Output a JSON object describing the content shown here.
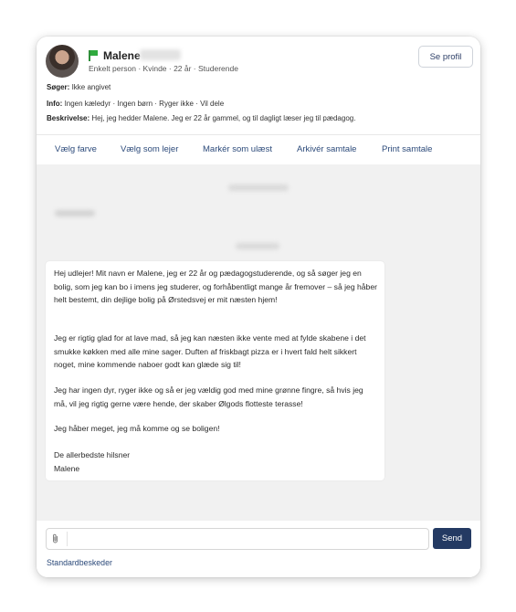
{
  "header": {
    "name": "Malene",
    "subinfo": "Enkelt person · Kvinde · 22 år · Studerende",
    "profile_button": "Se profil",
    "seeks_label": "Søger:",
    "seeks_value": "Ikke angivet",
    "info_label": "Info:",
    "info_value": "Ingen kæledyr · Ingen børn · Ryger ikke · Vil dele",
    "description_label": "Beskrivelse:",
    "description_value": "Hej, jeg hedder Malene. Jeg er 22 år gammel, og til dagligt læser jeg til pædagog."
  },
  "actions": [
    "Vælg farve",
    "Vælg som lejer",
    "Markér som ulæst",
    "Arkivér samtale",
    "Print samtale"
  ],
  "message": {
    "p1": "Hej udlejer! Mit navn er Malene, jeg er 22 år og pædagogstuderende, og så søger jeg en bolig, som jeg kan bo i imens jeg studerer, og forhåbentligt mange år fremover – så jeg håber helt bestemt, din dejlige bolig på Ørstedsvej er mit næsten hjem!",
    "p2": "Jeg er rigtig glad for at lave mad, så jeg kan næsten ikke vente med at fylde skabene i det smukke køkken med alle mine sager. Duften af friskbagt pizza er i hvert fald helt sikkert noget, mine kommende naboer godt kan glæde sig til!",
    "p3": "Jeg har ingen dyr, ryger ikke og så er jeg væld­ig god med mine grønne fingre, så hvis jeg må, vil jeg rigtig gerne være hende, der skaber Ølgods flotteste terasse!",
    "p4": "Jeg håber meget, jeg må komme og se boligen!",
    "p5_line1": "De allerbedste hilsner",
    "p5_line2": "Malene"
  },
  "composer": {
    "send_label": "Send",
    "standard_messages": "Standardbeskeder",
    "placeholder": ""
  },
  "icons": {
    "flag": "flag-icon",
    "attach": "paperclip-icon"
  },
  "colors": {
    "accent": "#2c4a7a",
    "send_button": "#243a63",
    "flag": "#2faa3e"
  }
}
